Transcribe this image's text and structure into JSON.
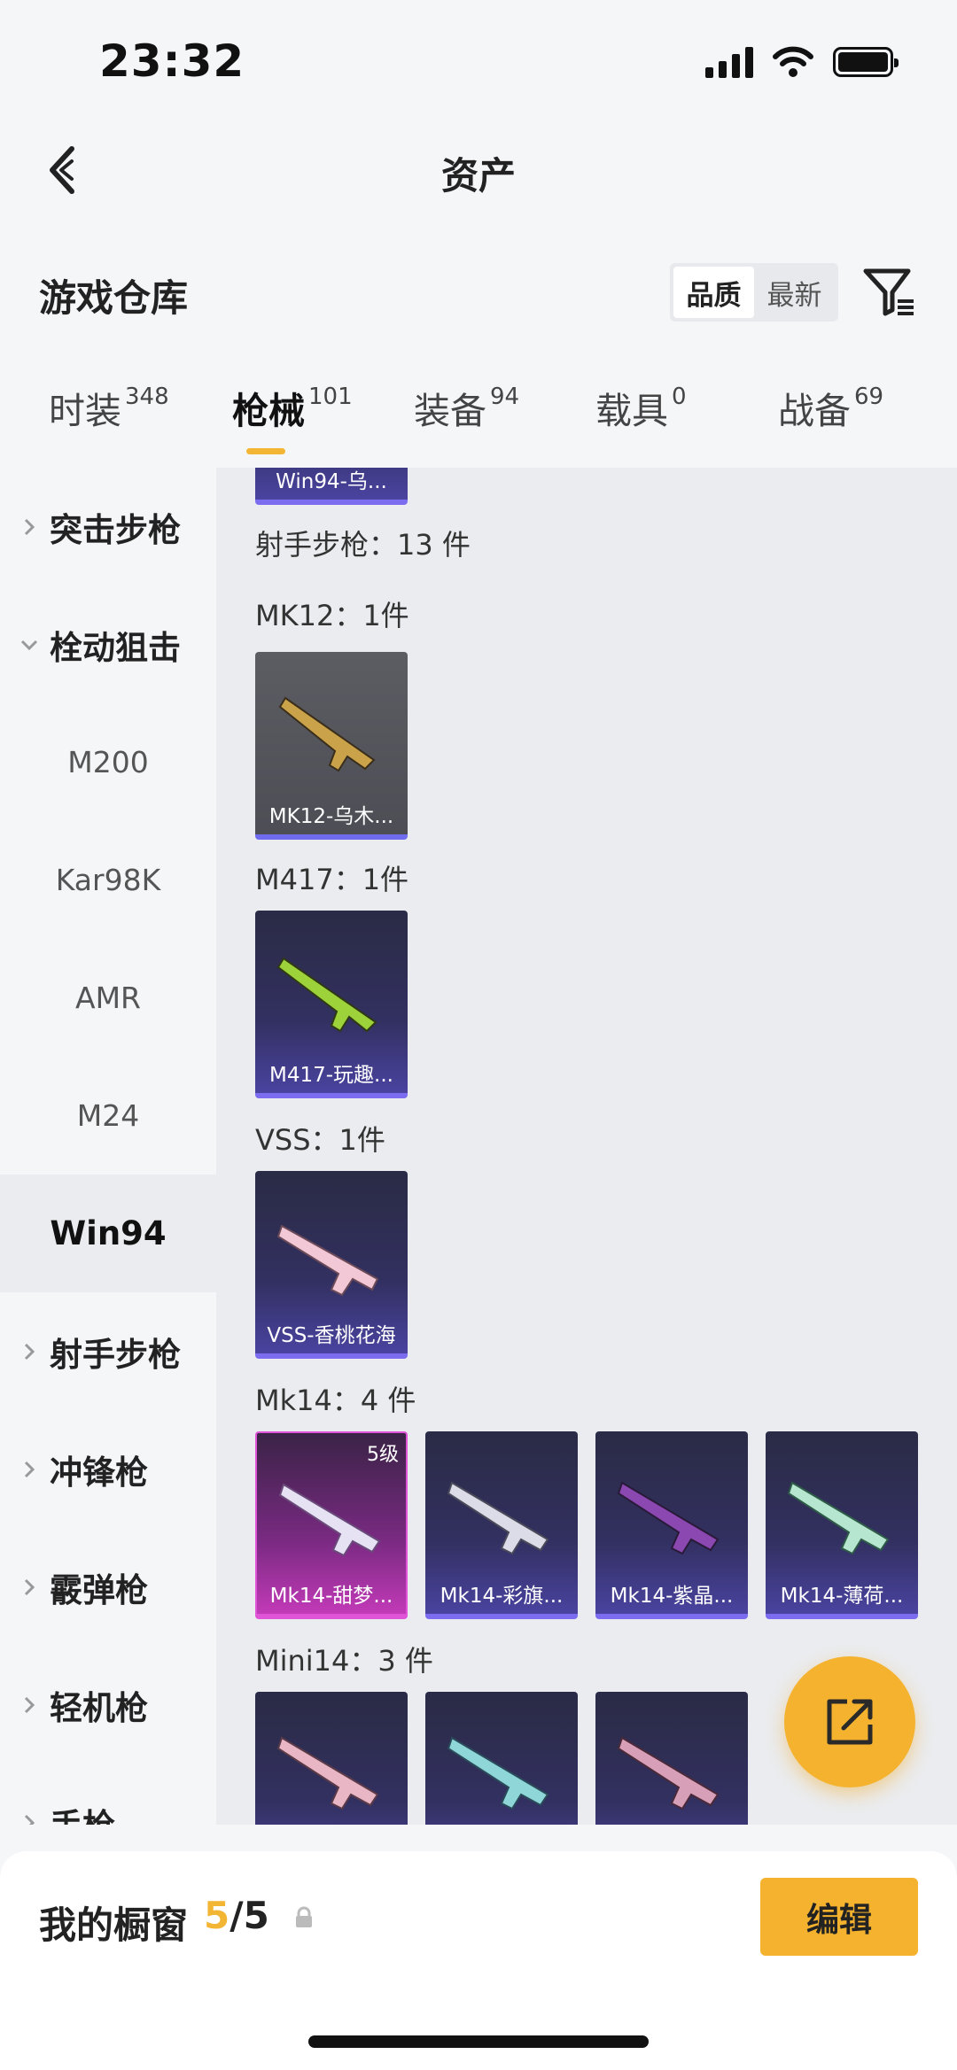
{
  "status": {
    "time": "23:32"
  },
  "nav": {
    "title": "资产"
  },
  "warehouse": {
    "title": "游戏仓库",
    "sort_options": [
      "品质",
      "最新"
    ],
    "sort_selected": "品质"
  },
  "tabs": [
    {
      "label": "时装",
      "count": "348"
    },
    {
      "label": "枪械",
      "count": "101",
      "active": true
    },
    {
      "label": "装备",
      "count": "94"
    },
    {
      "label": "载具",
      "count": "0"
    },
    {
      "label": "战备",
      "count": "69"
    }
  ],
  "sidebar": {
    "items": [
      {
        "label": "突击步枪",
        "type": "category",
        "expanded": false
      },
      {
        "label": "栓动狙击",
        "type": "category",
        "expanded": true
      },
      {
        "label": "M200",
        "type": "sub"
      },
      {
        "label": "Kar98K",
        "type": "sub"
      },
      {
        "label": "AMR",
        "type": "sub"
      },
      {
        "label": "M24",
        "type": "sub"
      },
      {
        "label": "Win94",
        "type": "sub",
        "selected": true
      },
      {
        "label": "射手步枪",
        "type": "category",
        "expanded": false
      },
      {
        "label": "冲锋枪",
        "type": "category",
        "expanded": false
      },
      {
        "label": "霰弹枪",
        "type": "category",
        "expanded": false
      },
      {
        "label": "轻机枪",
        "type": "category",
        "expanded": false
      },
      {
        "label": "手枪",
        "type": "category",
        "expanded": false
      }
    ]
  },
  "content": {
    "top_card": {
      "label": "Win94-乌..."
    },
    "section_title": "射手步枪：13 件",
    "groups": [
      {
        "title": "MK12：1件",
        "cards": [
          {
            "label": "MK12-乌木...",
            "style": "gray"
          }
        ]
      },
      {
        "title": "M417：1件",
        "cards": [
          {
            "label": "M417-玩趣...",
            "style": "purple"
          }
        ]
      },
      {
        "title": "VSS：1件",
        "cards": [
          {
            "label": "VSS-香桃花海",
            "style": "purple"
          }
        ]
      },
      {
        "title": "Mk14：4 件",
        "cards": [
          {
            "label": "Mk14-甜梦...",
            "style": "pink",
            "level": "5级"
          },
          {
            "label": "Mk14-彩旗...",
            "style": "purple"
          },
          {
            "label": "Mk14-紫晶...",
            "style": "purple"
          },
          {
            "label": "Mk14-薄荷...",
            "style": "purple"
          }
        ]
      },
      {
        "title": "Mini14：3 件",
        "cards": [
          {
            "label": "",
            "style": "purple"
          },
          {
            "label": "",
            "style": "purple"
          },
          {
            "label": "",
            "style": "purple"
          }
        ]
      }
    ]
  },
  "bottom": {
    "showcase_label": "我的橱窗",
    "showcase_current": "5",
    "showcase_sep_total": "/5",
    "edit_label": "编辑"
  },
  "colors": {
    "accent": "#f2b534",
    "fab": "#f4b22e",
    "card_purple": "#4a43a0",
    "card_pink": "#c23ab8"
  }
}
